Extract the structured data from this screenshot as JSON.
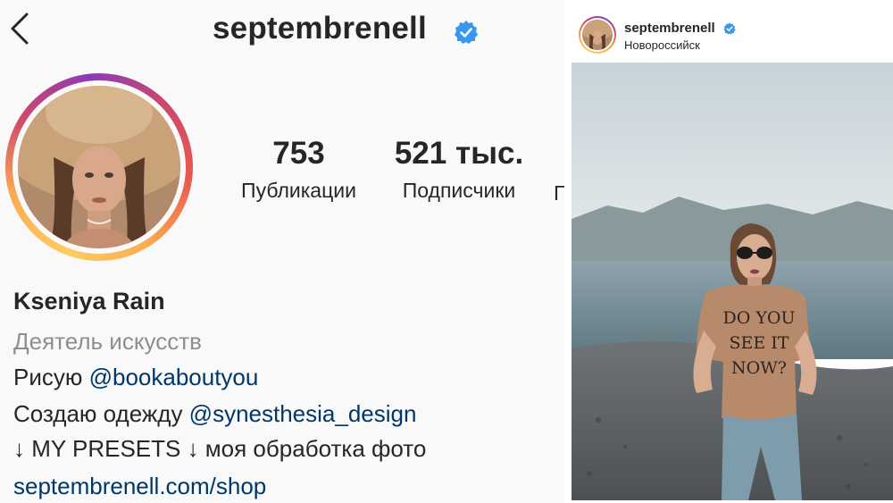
{
  "profile": {
    "username": "septembrenell",
    "stats": [
      {
        "value": "753",
        "label": "Публикации"
      },
      {
        "value": "521 тыс.",
        "label": "Подписчики"
      }
    ],
    "stats_cut_glyph": "Г",
    "name": "Kseniya Rain",
    "category": "Деятель искусств",
    "bio_lines": [
      {
        "text": "Рисую ",
        "mention": "@bookaboutyou"
      },
      {
        "text": "Создаю одежду ",
        "mention": "@synesthesia_design"
      },
      {
        "text": "↓ MY PRESETS ↓ моя обработка фото"
      }
    ],
    "link": "septembrenell.com/shop"
  },
  "post": {
    "username": "septembrenell",
    "location": "Новороссийск",
    "shirt_text": [
      "DO YOU",
      "SEE IT",
      "NOW?"
    ]
  },
  "colors": {
    "verified": "#3897f0",
    "text": "#262626",
    "secondary": "#8e8e8e",
    "link": "#00376b"
  },
  "icons": {
    "back": "chevron-left-icon",
    "verified": "verified-badge-icon"
  }
}
